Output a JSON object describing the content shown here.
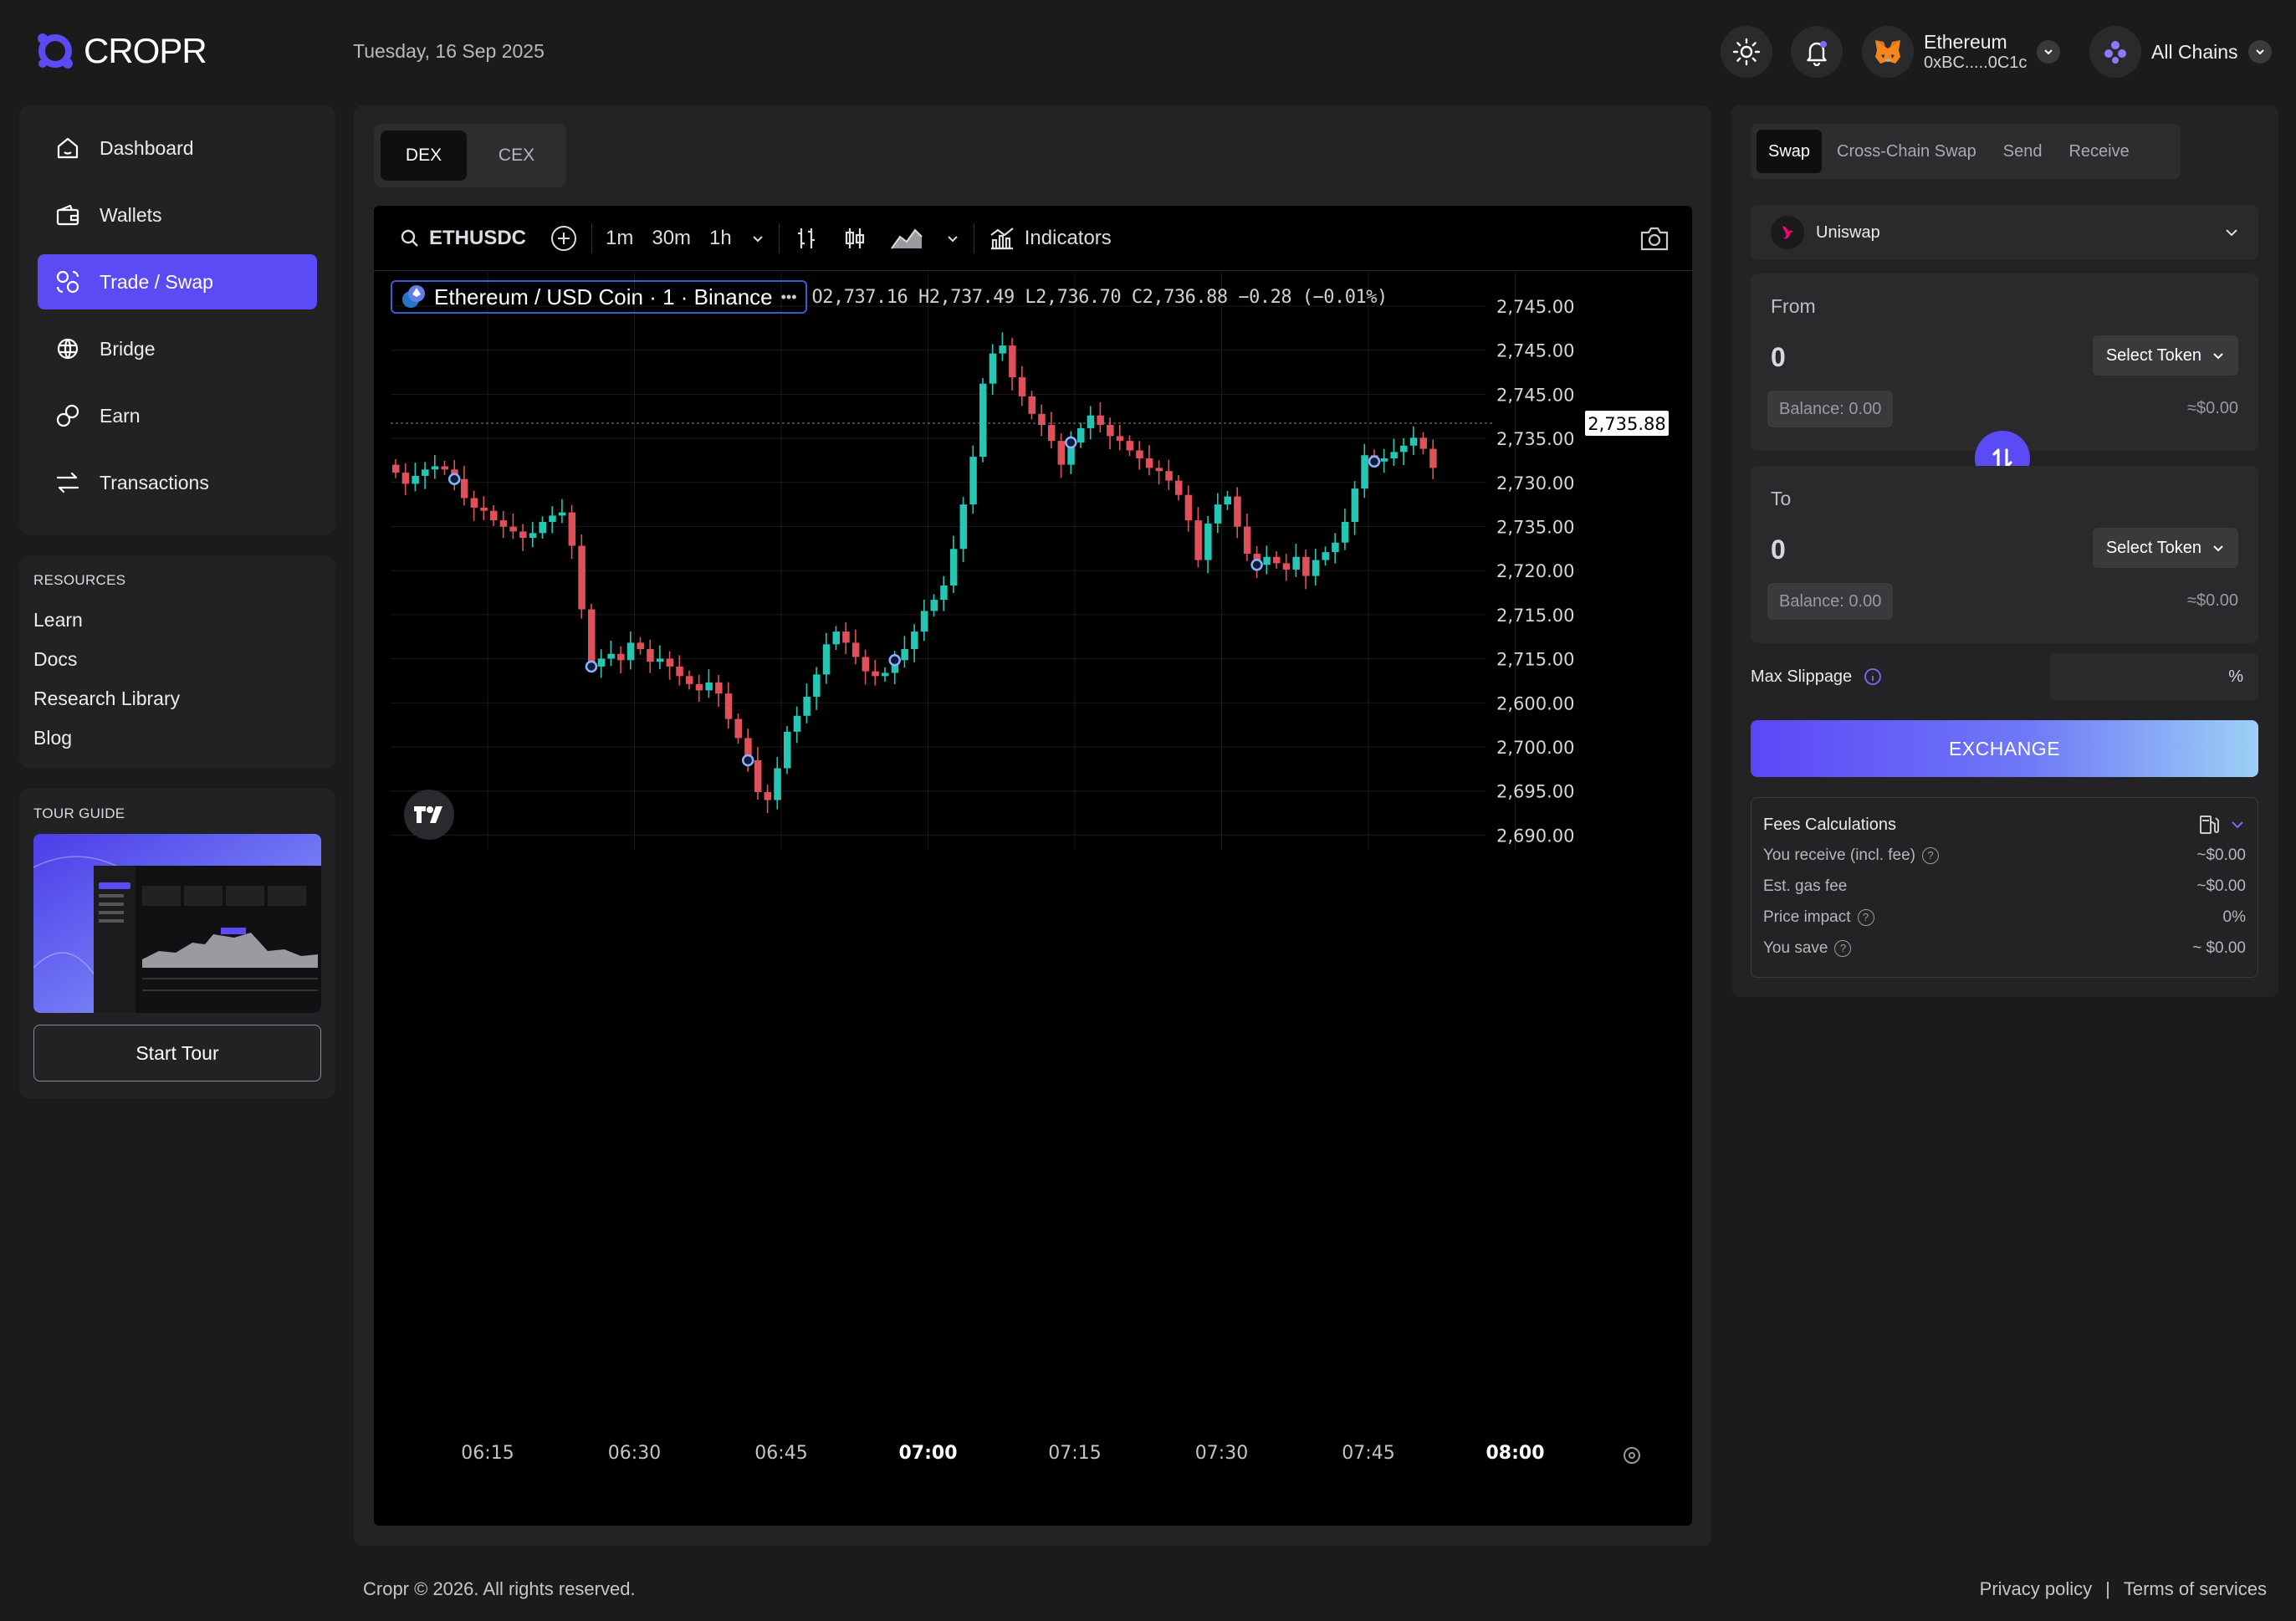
{
  "header": {
    "brand": "CROPR",
    "date": "Tuesday, 16 Sep 2025",
    "wallet_network": "Ethereum",
    "wallet_address": "0xBC.....0C1c",
    "chain_filter": "All Chains"
  },
  "sidebar": {
    "items": [
      {
        "label": "Dashboard",
        "icon": "home-icon"
      },
      {
        "label": "Wallets",
        "icon": "wallet-icon"
      },
      {
        "label": "Trade / Swap",
        "icon": "swap-icon",
        "active": true
      },
      {
        "label": "Bridge",
        "icon": "bridge-icon"
      },
      {
        "label": "Earn",
        "icon": "earn-icon"
      },
      {
        "label": "Transactions",
        "icon": "transactions-icon"
      }
    ],
    "resources_title": "RESOURCES",
    "resources": [
      "Learn",
      "Docs",
      "Research Library",
      "Blog"
    ],
    "tour_title": "TOUR GUIDE",
    "tour_button": "Start Tour"
  },
  "market": {
    "tabs": [
      "DEX",
      "CEX"
    ],
    "active_tab": "DEX"
  },
  "chart_toolbar": {
    "symbol": "ETHUSDC",
    "intervals": [
      "1m",
      "30m",
      "1h"
    ],
    "indicators": "Indicators"
  },
  "chart_legend": {
    "title": "Ethereum / USD Coin · 1 · Binance",
    "more": "•••",
    "ohlc": "O2,737.16  H2,737.49  L2,736.70  C2,736.88  −0.28 (−0.01%)"
  },
  "chart_data": {
    "type": "candlestick",
    "y_tick_labels": [
      "2,745.00",
      "2,745.00",
      "2,745.00",
      "2,735.00",
      "2,730.00",
      "2,735.00",
      "2,720.00",
      "2,715.00",
      "2,715.00",
      "2,600.00",
      "2,700.00",
      "2,695.00",
      "2,690.00"
    ],
    "last_price_label": "2,735.88",
    "x_tick_labels": [
      "06:15",
      "06:30",
      "06:45",
      "07:00",
      "07:15",
      "07:30",
      "07:45",
      "08:00"
    ],
    "x_bold_labels": [
      "07:00",
      "08:00"
    ],
    "up_color": "#26c6b5",
    "down_color": "#e0505a",
    "grid": true,
    "candles_close": [
      2736.6,
      2735.9,
      2736.4,
      2736.8,
      2737.0,
      2736.8,
      2736.2,
      2735.0,
      2734.4,
      2734.2,
      2733.6,
      2733.2,
      2732.9,
      2732.5,
      2732.8,
      2733.5,
      2733.9,
      2734.1,
      2732.0,
      2728.0,
      2724.4,
      2724.9,
      2725.2,
      2724.8,
      2725.9,
      2725.5,
      2724.7,
      2724.9,
      2724.4,
      2723.8,
      2723.3,
      2722.9,
      2723.4,
      2722.7,
      2721.1,
      2719.9,
      2718.5,
      2716.5,
      2716.0,
      2718.0,
      2720.3,
      2721.3,
      2722.5,
      2723.9,
      2725.8,
      2726.6,
      2725.9,
      2725.0,
      2724.1,
      2723.8,
      2724.0,
      2724.8,
      2725.5,
      2726.6,
      2727.9,
      2728.6,
      2729.5,
      2731.8,
      2734.6,
      2737.6,
      2742.2,
      2744.1,
      2744.6,
      2742.6,
      2741.4,
      2740.3,
      2739.6,
      2738.6,
      2737.1,
      2738.5,
      2739.4,
      2740.2,
      2739.6,
      2738.9,
      2738.6,
      2738.0,
      2737.5,
      2736.9,
      2736.7,
      2736.1,
      2735.2,
      2733.6,
      2731.1,
      2733.4,
      2734.6,
      2735.1,
      2733.2,
      2731.5,
      2730.8,
      2731.3,
      2730.9,
      2730.5,
      2731.3,
      2730.1,
      2731.1,
      2731.6,
      2732.2,
      2733.5,
      2735.6,
      2737.7,
      2737.3,
      2737.5,
      2737.9,
      2738.3,
      2738.8,
      2738.1,
      2736.9
    ]
  },
  "swap": {
    "tabs": [
      "Swap",
      "Cross-Chain Swap",
      "Send",
      "Receive"
    ],
    "active_tab": "Swap",
    "dex": "Uniswap",
    "from": {
      "label": "From",
      "amount": "0",
      "token_button": "Select Token",
      "balance": "Balance: 0.00",
      "usd": "≈$0.00"
    },
    "to": {
      "label": "To",
      "amount": "0",
      "token_button": "Select Token",
      "balance": "Balance: 0.00",
      "usd": "≈$0.00"
    },
    "max_slippage_label": "Max Slippage",
    "slippage_unit": "%",
    "exchange_button": "EXCHANGE",
    "fees": {
      "title": "Fees Calculations",
      "rows": [
        {
          "label": "You receive (incl. fee)",
          "value": "~$0.00",
          "help": true
        },
        {
          "label": "Est. gas fee",
          "value": "~$0.00",
          "help": false
        },
        {
          "label": "Price impact",
          "value": "0%",
          "help": true
        },
        {
          "label": "You save",
          "value": "~ $0.00",
          "help": true
        }
      ]
    }
  },
  "footer": {
    "copyright": "Cropr © 2026. All rights reserved.",
    "privacy": "Privacy policy",
    "separator": "|",
    "terms": "Terms of services"
  },
  "colors": {
    "accent": "#5b4bf5",
    "bg": "#1b1b1c",
    "panel": "#222224"
  }
}
